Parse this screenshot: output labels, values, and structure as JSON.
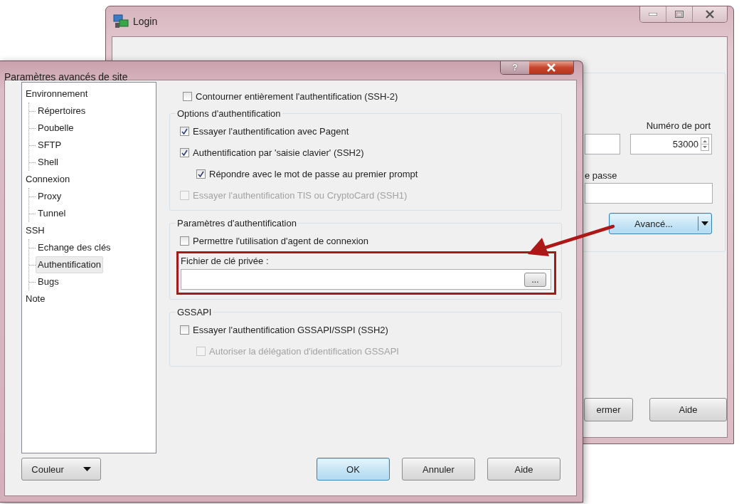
{
  "login_window": {
    "title": "Login",
    "port_label": "Numéro de port",
    "port_value": "53000",
    "password_label": "e passe",
    "advanced_button": "Avancé...",
    "buttons": [
      "ermer",
      "Aide"
    ]
  },
  "dialog": {
    "title": "Paramètres avancés de site",
    "help_button": "?",
    "tree": [
      {
        "label": "Environnement",
        "selected": false,
        "children": [
          {
            "label": "Répertoires",
            "selected": false
          },
          {
            "label": "Poubelle",
            "selected": false
          },
          {
            "label": "SFTP",
            "selected": false
          },
          {
            "label": "Shell",
            "selected": false
          }
        ]
      },
      {
        "label": "Connexion",
        "selected": false,
        "children": [
          {
            "label": "Proxy",
            "selected": false
          },
          {
            "label": "Tunnel",
            "selected": false
          }
        ]
      },
      {
        "label": "SSH",
        "selected": false,
        "children": [
          {
            "label": "Echange des clés",
            "selected": false
          },
          {
            "label": "Authentification",
            "selected": true
          },
          {
            "label": "Bugs",
            "selected": false
          }
        ]
      },
      {
        "label": "Note",
        "selected": false
      }
    ],
    "bypass": {
      "label": "Contourner entièrement l'authentification (SSH-2)",
      "checked": false,
      "disabled": false
    },
    "groups": [
      {
        "title": "Options d'authentification",
        "items": [
          {
            "kind": "checkbox",
            "label": "Essayer l'authentification avec Pagent",
            "checked": true,
            "disabled": false
          },
          {
            "kind": "checkbox",
            "label": "Authentification par 'saisie clavier' (SSH2)",
            "checked": true,
            "disabled": false,
            "children": [
              {
                "label": "Répondre avec le mot de passe au premier prompt",
                "checked": true,
                "disabled": false
              }
            ]
          },
          {
            "kind": "checkbox",
            "label": "Essayer l'authentification TIS ou CryptoCard (SSH1)",
            "checked": false,
            "disabled": true
          }
        ]
      },
      {
        "title": "Paramètres d'authentification",
        "items": [
          {
            "kind": "checkbox",
            "label": "Permettre l'utilisation d'agent de connexion",
            "checked": false,
            "disabled": false
          },
          {
            "kind": "file",
            "label": "Fichier de clé privée :",
            "browse_button": "..."
          }
        ]
      },
      {
        "title": "GSSAPI",
        "items": [
          {
            "kind": "checkbox",
            "label": "Essayer l'authentification GSSAPI/SSPI (SSH2)",
            "checked": false,
            "disabled": false,
            "children": [
              {
                "label": "Autoriser la délégation d'identification GSSAPI",
                "checked": false,
                "disabled": true
              }
            ]
          }
        ]
      }
    ],
    "color_button": "Couleur",
    "buttons": [
      {
        "label": "OK",
        "default": true
      },
      {
        "label": "Annuler",
        "default": false
      },
      {
        "label": "Aide",
        "default": false
      }
    ]
  }
}
